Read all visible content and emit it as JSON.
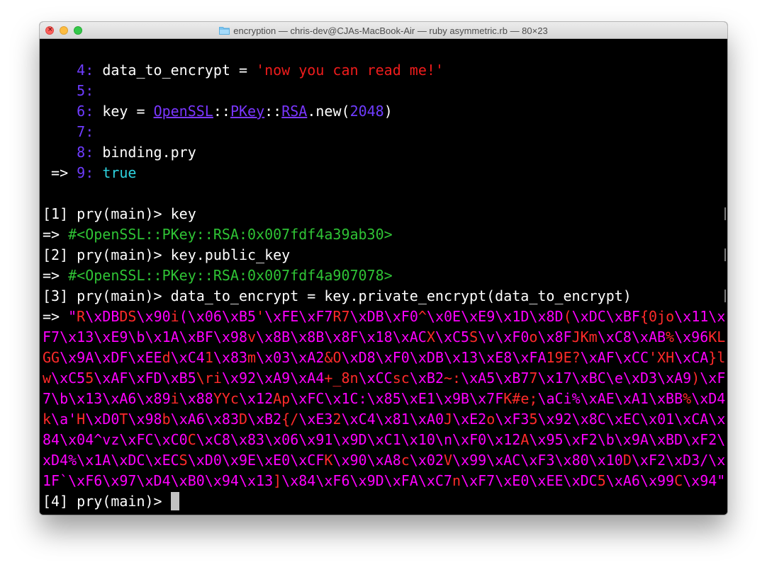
{
  "window": {
    "title": "encryption — chris-dev@CJAs-MacBook-Air — ruby asymmetric.rb — 80×23",
    "close_glyph": "×",
    "colors": {
      "close": "#fc605c",
      "minimize": "#fdbc40",
      "maximize": "#34c84a"
    }
  },
  "code": {
    "l4": {
      "num": "4",
      "colon": ": ",
      "var": "data_to_encrypt",
      "eq": " = ",
      "str": "'now you can read me!'"
    },
    "l5": {
      "num": "5",
      "colon": ":"
    },
    "l6": {
      "num": "6",
      "colon": ": ",
      "var": "key",
      "eq": " = ",
      "c1": "OpenSSL",
      "sep1": "::",
      "c2": "PKey",
      "sep2": "::",
      "c3": "RSA",
      "meth": ".new(",
      "arg": "2048",
      "close": ")"
    },
    "l7": {
      "num": "7",
      "colon": ":"
    },
    "l8": {
      "num": "8",
      "colon": ": ",
      "text": "binding.pry"
    },
    "l9": {
      "arrow": " => ",
      "num": "9",
      "colon": ": ",
      "kw": "true"
    }
  },
  "repl": [
    {
      "gutter": "[",
      "prompt": "[1] pry(main)> ",
      "input": "key"
    },
    {
      "arrow": "=> ",
      "result": "#<OpenSSL::PKey::RSA:0x007fdf4a39ab30>"
    },
    {
      "gutter": "[",
      "prompt": "[2] pry(main)> ",
      "input": "key.public_key"
    },
    {
      "arrow": "=> ",
      "result": "#<OpenSSL::PKey::RSA:0x007fdf4a907078>"
    },
    {
      "gutter": "[",
      "prompt": "[3] pry(main)> ",
      "input": "data_to_encrypt = key.private_encrypt(data_to_encrypt)"
    }
  ],
  "encrypted": [
    [
      [
        "w",
        "=> "
      ],
      [
        "m",
        "\""
      ],
      [
        "r",
        "R"
      ],
      [
        "m",
        "\\xDB"
      ],
      [
        "r",
        "DS"
      ],
      [
        "m",
        "\\x90"
      ],
      [
        "r",
        "i"
      ],
      [
        "m",
        "(\\x06\\xB5"
      ],
      [
        "r",
        "'"
      ],
      [
        "m",
        "\\xFE\\xF7"
      ],
      [
        "r",
        "R7"
      ],
      [
        "m",
        "\\xDB\\xF0"
      ],
      [
        "r",
        "^"
      ],
      [
        "m",
        "\\x0E\\xE9\\x1D\\x8D"
      ],
      [
        "r",
        "("
      ],
      [
        "m",
        "\\xDC\\xBF"
      ],
      [
        "r",
        "{0jo"
      ],
      [
        "m",
        "\\x11\\x"
      ]
    ],
    [
      [
        "m",
        "F7\\x13\\xE9\\b\\x1A\\xBF\\x98"
      ],
      [
        "r",
        "v"
      ],
      [
        "m",
        "\\x8B\\x8B\\x8F\\x18\\xAC"
      ],
      [
        "r",
        "X"
      ],
      [
        "m",
        "\\xC5"
      ],
      [
        "r",
        "S"
      ],
      [
        "m",
        "\\v\\xF0"
      ],
      [
        "r",
        "o"
      ],
      [
        "m",
        "\\x8F"
      ],
      [
        "r",
        "JKm"
      ],
      [
        "m",
        "\\xC8\\xAB"
      ],
      [
        "r",
        "%"
      ],
      [
        "m",
        "\\x96"
      ],
      [
        "r",
        "KL"
      ]
    ],
    [
      [
        "r",
        "GG"
      ],
      [
        "m",
        "\\x9A\\xDF\\xEE"
      ],
      [
        "r",
        "d"
      ],
      [
        "m",
        "\\xC4"
      ],
      [
        "r",
        "1"
      ],
      [
        "m",
        "\\x83"
      ],
      [
        "r",
        "m"
      ],
      [
        "m",
        "\\x03\\xA2"
      ],
      [
        "r",
        "&O"
      ],
      [
        "m",
        "\\xD8\\xF0\\xDB\\x13\\xE8\\xFA"
      ],
      [
        "r",
        "19E?"
      ],
      [
        "m",
        "\\xAF\\xCC"
      ],
      [
        "r",
        "'XH"
      ],
      [
        "m",
        "\\xCA"
      ],
      [
        "r",
        "}l"
      ]
    ],
    [
      [
        "r",
        "w"
      ],
      [
        "m",
        "\\xC5"
      ],
      [
        "r",
        "5"
      ],
      [
        "m",
        "\\xAF\\xFD\\xB5"
      ],
      [
        "r",
        "\\ri"
      ],
      [
        "m",
        "\\x92\\xA9\\xA4"
      ],
      [
        "r",
        "+_8n"
      ],
      [
        "m",
        "\\xCC"
      ],
      [
        "r",
        "sc"
      ],
      [
        "m",
        "\\xB2"
      ],
      [
        "r",
        "~:"
      ],
      [
        "m",
        "\\xA5\\xB7"
      ],
      [
        "r",
        "7"
      ],
      [
        "m",
        "\\x17\\xBC\\e\\xD3\\xA9"
      ],
      [
        "r",
        ")"
      ],
      [
        "m",
        "\\xF"
      ]
    ],
    [
      [
        "m",
        "7\\b\\x13\\xA6\\x89"
      ],
      [
        "r",
        "i"
      ],
      [
        "m",
        "\\x88"
      ],
      [
        "r",
        "YYc"
      ],
      [
        "m",
        "\\x12"
      ],
      [
        "r",
        "Ap"
      ],
      [
        "m",
        "\\xFC\\x1C:\\x85\\xE1\\x9B\\x7F"
      ],
      [
        "r",
        "K#e;"
      ],
      [
        "m",
        "\\aCi%\\xAE\\xA1\\xBB"
      ],
      [
        "r",
        "%"
      ],
      [
        "m",
        "\\xD4"
      ]
    ],
    [
      [
        "r",
        "k"
      ],
      [
        "m",
        "\\a'"
      ],
      [
        "r",
        "H"
      ],
      [
        "m",
        "\\xD0"
      ],
      [
        "r",
        "T"
      ],
      [
        "m",
        "\\x98"
      ],
      [
        "r",
        "b"
      ],
      [
        "m",
        "\\xA6\\x83"
      ],
      [
        "r",
        "D"
      ],
      [
        "m",
        "\\xB2"
      ],
      [
        "r",
        "{/"
      ],
      [
        "m",
        "\\xE3"
      ],
      [
        "r",
        "2"
      ],
      [
        "m",
        "\\xC4\\x81\\xA0"
      ],
      [
        "r",
        "J"
      ],
      [
        "m",
        "\\xE2"
      ],
      [
        "r",
        "o"
      ],
      [
        "m",
        "\\xF3"
      ],
      [
        "r",
        "5"
      ],
      [
        "m",
        "\\x92\\x8C\\xEC\\x01\\xCA\\x"
      ]
    ],
    [
      [
        "m",
        "84\\x04^vz\\xFC\\xC0"
      ],
      [
        "r",
        "C"
      ],
      [
        "m",
        "\\xC8\\x83\\x06\\x91\\x9D\\xC1\\x10\\n\\xF0\\x12"
      ],
      [
        "r",
        "A"
      ],
      [
        "m",
        "\\x95\\xF2\\b\\x9A\\xBD\\xF2\\"
      ]
    ],
    [
      [
        "m",
        "xD4%\\x1A\\xDC\\xEC"
      ],
      [
        "r",
        "S"
      ],
      [
        "m",
        "\\xD0\\x9E\\xE0\\xCF"
      ],
      [
        "r",
        "K"
      ],
      [
        "m",
        "\\x90\\xA8"
      ],
      [
        "r",
        "c"
      ],
      [
        "m",
        "\\x02"
      ],
      [
        "r",
        "V"
      ],
      [
        "m",
        "\\x99\\xAC\\xF3\\x80\\x10"
      ],
      [
        "r",
        "D"
      ],
      [
        "m",
        "\\xF2\\xD3/\\x"
      ]
    ],
    [
      [
        "m",
        "1F`\\xF6\\x97\\xD4\\xB0\\x94\\x13"
      ],
      [
        "r",
        "]"
      ],
      [
        "m",
        "\\x84\\xF6\\x9D\\xFA\\xC7"
      ],
      [
        "r",
        "n"
      ],
      [
        "m",
        "\\xF7\\xE0\\xEE\\xDC"
      ],
      [
        "r",
        "5"
      ],
      [
        "m",
        "\\xA6\\x99"
      ],
      [
        "r",
        "C"
      ],
      [
        "m",
        "\\x94\""
      ]
    ]
  ],
  "final_prompt": "[4] pry(main)> "
}
